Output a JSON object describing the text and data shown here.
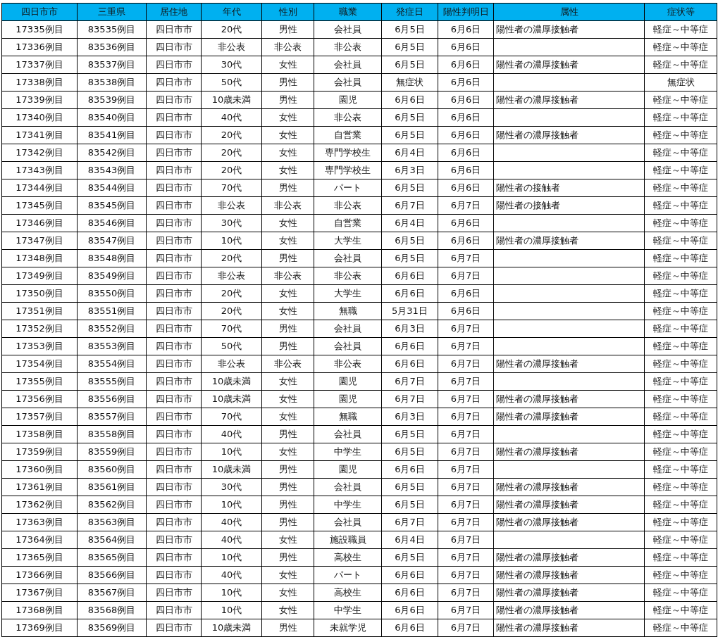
{
  "table": {
    "columns": [
      "四日市市",
      "三重県",
      "居住地",
      "年代",
      "性別",
      "職業",
      "発症日",
      "陽性判明日",
      "属性",
      "症状等"
    ],
    "rows": [
      {
        "city_case": "17335例目",
        "pref_case": "83535例目",
        "residence": "四日市市",
        "age": "20代",
        "sex": "男性",
        "occupation": "会社員",
        "onset_date": "6月5日",
        "positive_date": "6月6日",
        "attribute": "陽性者の濃厚接触者",
        "symptoms": "軽症～中等症"
      },
      {
        "city_case": "17336例目",
        "pref_case": "83536例目",
        "residence": "四日市市",
        "age": "非公表",
        "sex": "非公表",
        "occupation": "非公表",
        "onset_date": "6月5日",
        "positive_date": "6月6日",
        "symptoms": "軽症～中等症"
      },
      {
        "city_case": "17337例目",
        "pref_case": "83537例目",
        "residence": "四日市市",
        "age": "30代",
        "sex": "女性",
        "occupation": "会社員",
        "onset_date": "6月5日",
        "positive_date": "6月6日",
        "attribute": "陽性者の濃厚接触者",
        "symptoms": "軽症～中等症"
      },
      {
        "city_case": "17338例目",
        "pref_case": "83538例目",
        "residence": "四日市市",
        "age": "50代",
        "sex": "男性",
        "occupation": "会社員",
        "onset_date": "無症状",
        "positive_date": "6月6日",
        "symptoms": "無症状"
      },
      {
        "city_case": "17339例目",
        "pref_case": "83539例目",
        "residence": "四日市市",
        "age": "10歳未満",
        "sex": "男性",
        "occupation": "園児",
        "onset_date": "6月6日",
        "positive_date": "6月6日",
        "attribute": "陽性者の濃厚接触者",
        "symptoms": "軽症～中等症"
      },
      {
        "city_case": "17340例目",
        "pref_case": "83540例目",
        "residence": "四日市市",
        "age": "40代",
        "sex": "女性",
        "occupation": "非公表",
        "onset_date": "6月5日",
        "positive_date": "6月6日",
        "symptoms": "軽症～中等症"
      },
      {
        "city_case": "17341例目",
        "pref_case": "83541例目",
        "residence": "四日市市",
        "age": "20代",
        "sex": "女性",
        "occupation": "自営業",
        "onset_date": "6月5日",
        "positive_date": "6月6日",
        "attribute": "陽性者の濃厚接触者",
        "symptoms": "軽症～中等症"
      },
      {
        "city_case": "17342例目",
        "pref_case": "83542例目",
        "residence": "四日市市",
        "age": "20代",
        "sex": "女性",
        "occupation": "専門学校生",
        "onset_date": "6月4日",
        "positive_date": "6月6日",
        "symptoms": "軽症～中等症"
      },
      {
        "city_case": "17343例目",
        "pref_case": "83543例目",
        "residence": "四日市市",
        "age": "20代",
        "sex": "女性",
        "occupation": "専門学校生",
        "onset_date": "6月3日",
        "positive_date": "6月6日",
        "symptoms": "軽症～中等症"
      },
      {
        "city_case": "17344例目",
        "pref_case": "83544例目",
        "residence": "四日市市",
        "age": "70代",
        "sex": "男性",
        "occupation": "パート",
        "onset_date": "6月5日",
        "positive_date": "6月6日",
        "attribute": "陽性者の接触者",
        "symptoms": "軽症～中等症"
      },
      {
        "city_case": "17345例目",
        "pref_case": "83545例目",
        "residence": "四日市市",
        "age": "非公表",
        "sex": "非公表",
        "occupation": "非公表",
        "onset_date": "6月7日",
        "positive_date": "6月7日",
        "attribute": "陽性者の接触者",
        "symptoms": "軽症～中等症"
      },
      {
        "city_case": "17346例目",
        "pref_case": "83546例目",
        "residence": "四日市市",
        "age": "30代",
        "sex": "女性",
        "occupation": "自営業",
        "onset_date": "6月4日",
        "positive_date": "6月6日",
        "symptoms": "軽症～中等症"
      },
      {
        "city_case": "17347例目",
        "pref_case": "83547例目",
        "residence": "四日市市",
        "age": "10代",
        "sex": "女性",
        "occupation": "大学生",
        "onset_date": "6月5日",
        "positive_date": "6月6日",
        "attribute": "陽性者の濃厚接触者",
        "symptoms": "軽症～中等症"
      },
      {
        "city_case": "17348例目",
        "pref_case": "83548例目",
        "residence": "四日市市",
        "age": "20代",
        "sex": "男性",
        "occupation": "会社員",
        "onset_date": "6月5日",
        "positive_date": "6月7日",
        "symptoms": "軽症～中等症"
      },
      {
        "city_case": "17349例目",
        "pref_case": "83549例目",
        "residence": "四日市市",
        "age": "非公表",
        "sex": "非公表",
        "occupation": "非公表",
        "onset_date": "6月6日",
        "positive_date": "6月7日",
        "symptoms": "軽症～中等症"
      },
      {
        "city_case": "17350例目",
        "pref_case": "83550例目",
        "residence": "四日市市",
        "age": "20代",
        "sex": "女性",
        "occupation": "大学生",
        "onset_date": "6月6日",
        "positive_date": "6月6日",
        "symptoms": "軽症～中等症"
      },
      {
        "city_case": "17351例目",
        "pref_case": "83551例目",
        "residence": "四日市市",
        "age": "20代",
        "sex": "女性",
        "occupation": "無職",
        "onset_date": "5月31日",
        "positive_date": "6月6日",
        "symptoms": "軽症～中等症"
      },
      {
        "city_case": "17352例目",
        "pref_case": "83552例目",
        "residence": "四日市市",
        "age": "70代",
        "sex": "男性",
        "occupation": "会社員",
        "onset_date": "6月3日",
        "positive_date": "6月7日",
        "symptoms": "軽症～中等症"
      },
      {
        "city_case": "17353例目",
        "pref_case": "83553例目",
        "residence": "四日市市",
        "age": "50代",
        "sex": "男性",
        "occupation": "会社員",
        "onset_date": "6月6日",
        "positive_date": "6月7日",
        "symptoms": "軽症～中等症"
      },
      {
        "city_case": "17354例目",
        "pref_case": "83554例目",
        "residence": "四日市市",
        "age": "非公表",
        "sex": "非公表",
        "occupation": "非公表",
        "onset_date": "6月6日",
        "positive_date": "6月7日",
        "attribute": "陽性者の濃厚接触者",
        "symptoms": "軽症～中等症"
      },
      {
        "city_case": "17355例目",
        "pref_case": "83555例目",
        "residence": "四日市市",
        "age": "10歳未満",
        "sex": "女性",
        "occupation": "園児",
        "onset_date": "6月7日",
        "positive_date": "6月7日",
        "symptoms": "軽症～中等症"
      },
      {
        "city_case": "17356例目",
        "pref_case": "83556例目",
        "residence": "四日市市",
        "age": "10歳未満",
        "sex": "女性",
        "occupation": "園児",
        "onset_date": "6月7日",
        "positive_date": "6月7日",
        "attribute": "陽性者の濃厚接触者",
        "symptoms": "軽症～中等症"
      },
      {
        "city_case": "17357例目",
        "pref_case": "83557例目",
        "residence": "四日市市",
        "age": "70代",
        "sex": "女性",
        "occupation": "無職",
        "onset_date": "6月3日",
        "positive_date": "6月7日",
        "attribute": "陽性者の濃厚接触者",
        "symptoms": "軽症～中等症"
      },
      {
        "city_case": "17358例目",
        "pref_case": "83558例目",
        "residence": "四日市市",
        "age": "40代",
        "sex": "男性",
        "occupation": "会社員",
        "onset_date": "6月5日",
        "positive_date": "6月7日",
        "symptoms": "軽症～中等症"
      },
      {
        "city_case": "17359例目",
        "pref_case": "83559例目",
        "residence": "四日市市",
        "age": "10代",
        "sex": "女性",
        "occupation": "中学生",
        "onset_date": "6月5日",
        "positive_date": "6月7日",
        "attribute": "陽性者の濃厚接触者",
        "symptoms": "軽症～中等症"
      },
      {
        "city_case": "17360例目",
        "pref_case": "83560例目",
        "residence": "四日市市",
        "age": "10歳未満",
        "sex": "男性",
        "occupation": "園児",
        "onset_date": "6月6日",
        "positive_date": "6月7日",
        "symptoms": "軽症～中等症"
      },
      {
        "city_case": "17361例目",
        "pref_case": "83561例目",
        "residence": "四日市市",
        "age": "30代",
        "sex": "男性",
        "occupation": "会社員",
        "onset_date": "6月5日",
        "positive_date": "6月7日",
        "attribute": "陽性者の濃厚接触者",
        "symptoms": "軽症～中等症"
      },
      {
        "city_case": "17362例目",
        "pref_case": "83562例目",
        "residence": "四日市市",
        "age": "10代",
        "sex": "男性",
        "occupation": "中学生",
        "onset_date": "6月5日",
        "positive_date": "6月7日",
        "attribute": "陽性者の濃厚接触者",
        "symptoms": "軽症～中等症"
      },
      {
        "city_case": "17363例目",
        "pref_case": "83563例目",
        "residence": "四日市市",
        "age": "40代",
        "sex": "男性",
        "occupation": "会社員",
        "onset_date": "6月7日",
        "positive_date": "6月7日",
        "attribute": "陽性者の濃厚接触者",
        "symptoms": "軽症～中等症"
      },
      {
        "city_case": "17364例目",
        "pref_case": "83564例目",
        "residence": "四日市市",
        "age": "40代",
        "sex": "女性",
        "occupation": "施設職員",
        "onset_date": "6月4日",
        "positive_date": "6月7日",
        "symptoms": "軽症～中等症"
      },
      {
        "city_case": "17365例目",
        "pref_case": "83565例目",
        "residence": "四日市市",
        "age": "10代",
        "sex": "男性",
        "occupation": "高校生",
        "onset_date": "6月5日",
        "positive_date": "6月7日",
        "attribute": "陽性者の濃厚接触者",
        "symptoms": "軽症～中等症"
      },
      {
        "city_case": "17366例目",
        "pref_case": "83566例目",
        "residence": "四日市市",
        "age": "40代",
        "sex": "女性",
        "occupation": "パート",
        "onset_date": "6月6日",
        "positive_date": "6月7日",
        "attribute": "陽性者の濃厚接触者",
        "symptoms": "軽症～中等症"
      },
      {
        "city_case": "17367例目",
        "pref_case": "83567例目",
        "residence": "四日市市",
        "age": "10代",
        "sex": "女性",
        "occupation": "高校生",
        "onset_date": "6月6日",
        "positive_date": "6月7日",
        "attribute": "陽性者の濃厚接触者",
        "symptoms": "軽症～中等症"
      },
      {
        "city_case": "17368例目",
        "pref_case": "83568例目",
        "residence": "四日市市",
        "age": "10代",
        "sex": "女性",
        "occupation": "中学生",
        "onset_date": "6月6日",
        "positive_date": "6月7日",
        "attribute": "陽性者の濃厚接触者",
        "symptoms": "軽症～中等症"
      },
      {
        "city_case": "17369例目",
        "pref_case": "83569例目",
        "residence": "四日市市",
        "age": "10歳未満",
        "sex": "男性",
        "occupation": "未就学児",
        "onset_date": "6月6日",
        "positive_date": "6月7日",
        "attribute": "陽性者の濃厚接触者",
        "symptoms": "軽症～中等症"
      }
    ]
  }
}
